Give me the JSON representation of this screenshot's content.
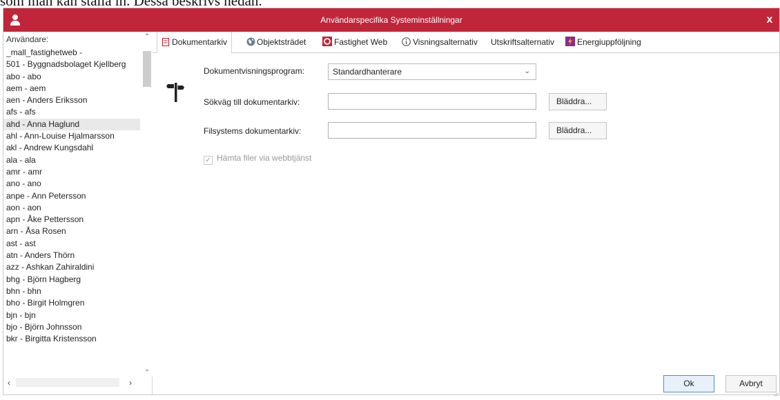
{
  "doc_text": "som man kan ställa in. Dessa beskrivs nedan.",
  "window": {
    "title": "Användarspecifika Systeminställningar",
    "close_glyph": "x",
    "accent_color": "#c0253a"
  },
  "sidebar": {
    "header": "Användare:",
    "selected_index": 6,
    "users": [
      "_mall_fastighetweb -",
      "501 - Byggnadsbolaget Kjellberg",
      "abo - abo",
      "aem - aem",
      "aen - Anders Eriksson",
      "afs - afs",
      "ahd - Anna Haglund",
      "ahl - Ann-Louise Hjalmarsson",
      "akl - Andrew Kungsdahl",
      "ala - ala",
      "amr - amr",
      "ano - ano",
      "anpe - Ann Petersson",
      "aon - aon",
      "apn - Åke Pettersson",
      "arn - Åsa Rosen",
      "ast - ast",
      "atn - Anders Thörn",
      "azz - Ashkan Zahiraldini",
      "bhg - Björn Hagberg",
      "bhn - bhn",
      "bho - Birgit Holmgren",
      "bjn - bjn",
      "bjo - Björn Johnsson",
      "bkr - Birgitta Kristensson"
    ]
  },
  "tabs": [
    {
      "label": "Dokumentarkiv",
      "icon": "document-archive-icon",
      "active": true
    },
    {
      "label": "Objektsträdet",
      "icon": "globe-icon",
      "active": false
    },
    {
      "label": "Fastighet Web",
      "icon": "fastighet-web-icon",
      "active": false
    },
    {
      "label": "Visningsalternativ",
      "icon": "info-icon",
      "active": false
    },
    {
      "label": "Utskriftsalternativ",
      "icon": "",
      "active": false
    },
    {
      "label": "Energiuppföljning",
      "icon": "energy-icon",
      "active": false
    }
  ],
  "form": {
    "viewer_label": "Dokumentvisningsprogram:",
    "viewer_value": "Standardhanterare",
    "archive_path_label": "Sökväg till dokumentarkiv:",
    "archive_path_value": "",
    "filesystem_label": "Filsystems dokumentarkiv:",
    "filesystem_value": "",
    "browse_label": "Bläddra...",
    "webservice_checkbox_label": "Hämta filer via webbtjänst",
    "webservice_checked": true
  },
  "footer": {
    "ok_label": "Ok",
    "cancel_label": "Avbryt"
  }
}
